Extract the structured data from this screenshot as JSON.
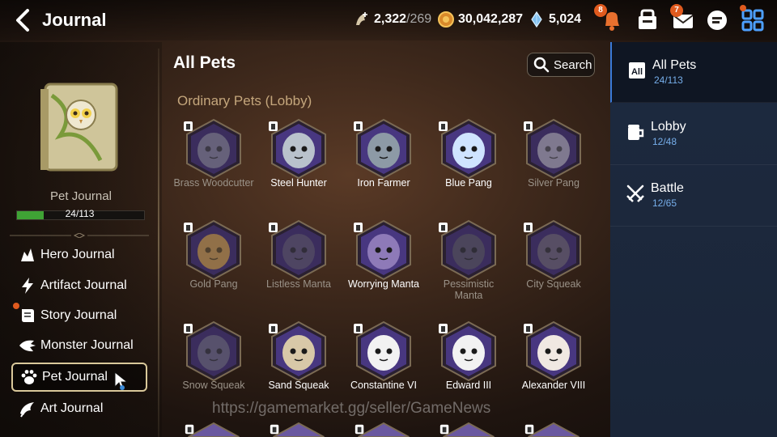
{
  "header": {
    "title": "Journal",
    "stamina": {
      "value": "2,322",
      "max": "/269"
    },
    "gold": "30,042,287",
    "crystals": "5,024",
    "notifications_badge": "8",
    "mail_badge": "7"
  },
  "sidebar": {
    "pet_journal_label": "Pet Journal",
    "progress_text": "24/113",
    "progress_fraction": 0.212,
    "menu": [
      {
        "label": "Hero Journal",
        "icon": "hero-icon"
      },
      {
        "label": "Artifact Journal",
        "icon": "artifact-icon"
      },
      {
        "label": "Story Journal",
        "icon": "story-icon"
      },
      {
        "label": "Monster Journal",
        "icon": "monster-icon"
      },
      {
        "label": "Pet Journal",
        "icon": "paw-icon"
      },
      {
        "label": "Art Journal",
        "icon": "art-icon"
      }
    ]
  },
  "main": {
    "title": "All Pets",
    "search_label": "Search",
    "section_label": "Ordinary Pets (Lobby)",
    "pets": [
      {
        "name": "Brass Woodcutter",
        "dim": true,
        "color": "#8a8d91"
      },
      {
        "name": "Steel Hunter",
        "dim": false,
        "color": "#b9c2cc"
      },
      {
        "name": "Iron Farmer",
        "dim": false,
        "color": "#8d9aa6"
      },
      {
        "name": "Blue Pang",
        "dim": false,
        "color": "#cfe4ff"
      },
      {
        "name": "Silver Pang",
        "dim": true,
        "color": "#b8b8b8"
      },
      {
        "name": "Gold Pang",
        "dim": true,
        "color": "#d8a836"
      },
      {
        "name": "Listless Manta",
        "dim": true,
        "color": "#5e5a66"
      },
      {
        "name": "Worrying Manta",
        "dim": false,
        "color": "#8e7ab8"
      },
      {
        "name": "Pessimistic Manta",
        "dim": true,
        "color": "#5a5a5a"
      },
      {
        "name": "City Squeak",
        "dim": true,
        "color": "#6f6a6a"
      },
      {
        "name": "Snow Squeak",
        "dim": true,
        "color": "#707078"
      },
      {
        "name": "Sand Squeak",
        "dim": false,
        "color": "#d8c8a8"
      },
      {
        "name": "Constantine VI",
        "dim": false,
        "color": "#f2f2f2"
      },
      {
        "name": "Edward III",
        "dim": false,
        "color": "#f2f2f2"
      },
      {
        "name": "Alexander VIII",
        "dim": false,
        "color": "#f0e8e2"
      }
    ]
  },
  "tabs": [
    {
      "label": "All Pets",
      "count": "24/113"
    },
    {
      "label": "Lobby",
      "count": "12/48"
    },
    {
      "label": "Battle",
      "count": "12/65"
    }
  ],
  "watermark": "https://gamemarket.gg/seller/GameNews",
  "colors": {
    "accent_green": "#3fa335",
    "tab_count_blue": "#76aeea",
    "section_tan": "#c4a67c",
    "tab_bg": "#1d2a3f",
    "hex_purple": "#4b3a8a"
  }
}
